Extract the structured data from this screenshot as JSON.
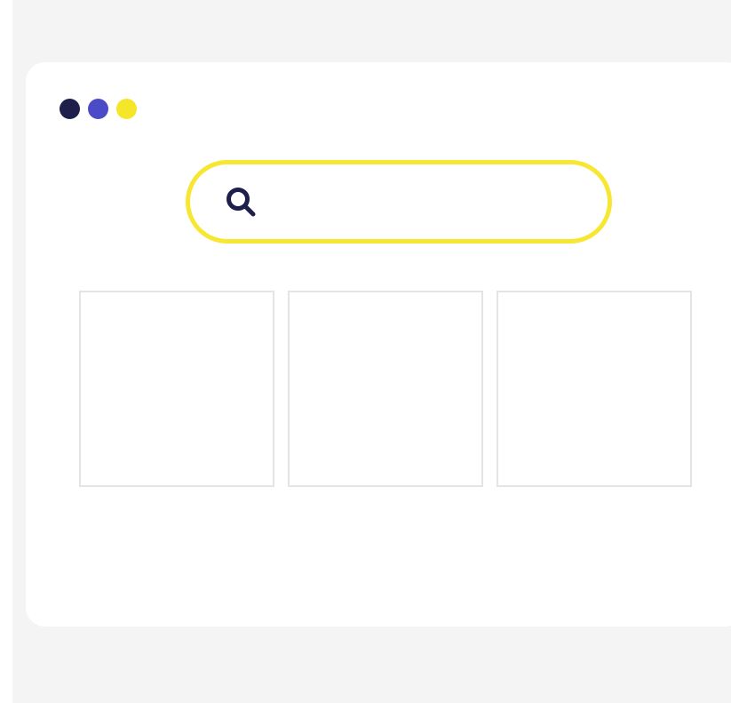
{
  "window": {
    "dots": [
      {
        "name": "window-dot-navy",
        "color": "#1e1f4a"
      },
      {
        "name": "window-dot-indigo",
        "color": "#4b4bc8"
      },
      {
        "name": "window-dot-yellow",
        "color": "#f5e62a"
      }
    ]
  },
  "search": {
    "icon": "search-icon",
    "value": "",
    "placeholder": "",
    "border_color": "#f7e733",
    "icon_color": "#1e1f4a"
  },
  "cards": [
    {
      "name": "card-1"
    },
    {
      "name": "card-2"
    },
    {
      "name": "card-3"
    }
  ]
}
